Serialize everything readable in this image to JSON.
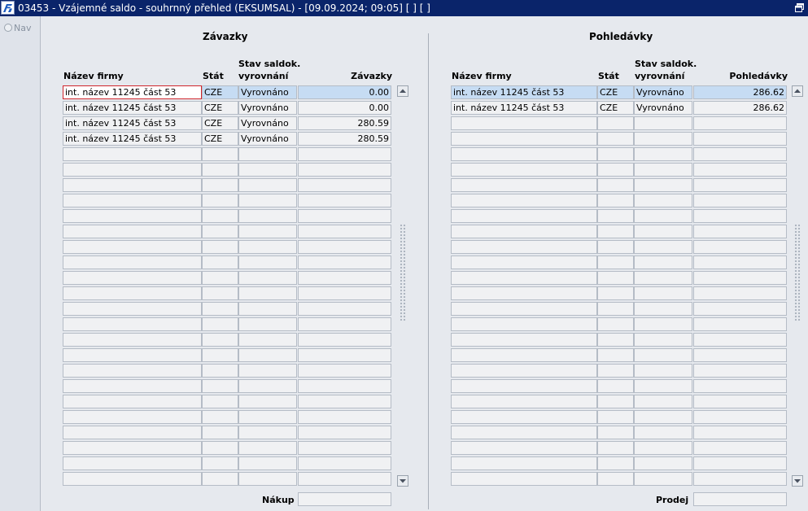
{
  "window": {
    "title": "03453 - Vzájemné saldo - souhrnný přehled (EKSUMSAL) - [09.09.2024; 09:05]  [ ] [ ]"
  },
  "nav": {
    "label": "Nav"
  },
  "left": {
    "title": "Závazky",
    "headers": {
      "name": "Název firmy",
      "state": "Stát",
      "status_line1": "Stav saldok.",
      "status_line2": "vyrovnání",
      "amount": "Závazky"
    },
    "rows": [
      {
        "name": "int. název 11245 část 53",
        "state": "CZE",
        "status": "Vyrovnáno",
        "amount": "0.00"
      },
      {
        "name": "int. název 11245 část 53",
        "state": "CZE",
        "status": "Vyrovnáno",
        "amount": "0.00"
      },
      {
        "name": "int. název 11245 část 53",
        "state": "CZE",
        "status": "Vyrovnáno",
        "amount": "280.59"
      },
      {
        "name": "int. název 11245 část 53",
        "state": "CZE",
        "status": "Vyrovnáno",
        "amount": "280.59"
      }
    ],
    "total_label": "Nákup",
    "total_value": ""
  },
  "right": {
    "title": "Pohledávky",
    "headers": {
      "name": "Název firmy",
      "state": "Stát",
      "status_line1": "Stav saldok.",
      "status_line2": "vyrovnání",
      "amount": "Pohledávky"
    },
    "rows": [
      {
        "name": "int. název 11245 část 53",
        "state": "CZE",
        "status": "Vyrovnáno",
        "amount": "286.62"
      },
      {
        "name": "int. název 11245 část 53",
        "state": "CZE",
        "status": "Vyrovnáno",
        "amount": "286.62"
      }
    ],
    "total_label": "Prodej",
    "total_value": ""
  },
  "colors": {
    "titlebar": "#0a246a",
    "selected_row": "#c6dcf3",
    "focus_border": "#d0262c",
    "cell_bg": "#f0f1f3"
  },
  "icons": {
    "app": "app-logo-icon",
    "restore": "restore-window-icon",
    "scroll_up": "arrow-up-icon",
    "scroll_down": "arrow-down-icon"
  }
}
